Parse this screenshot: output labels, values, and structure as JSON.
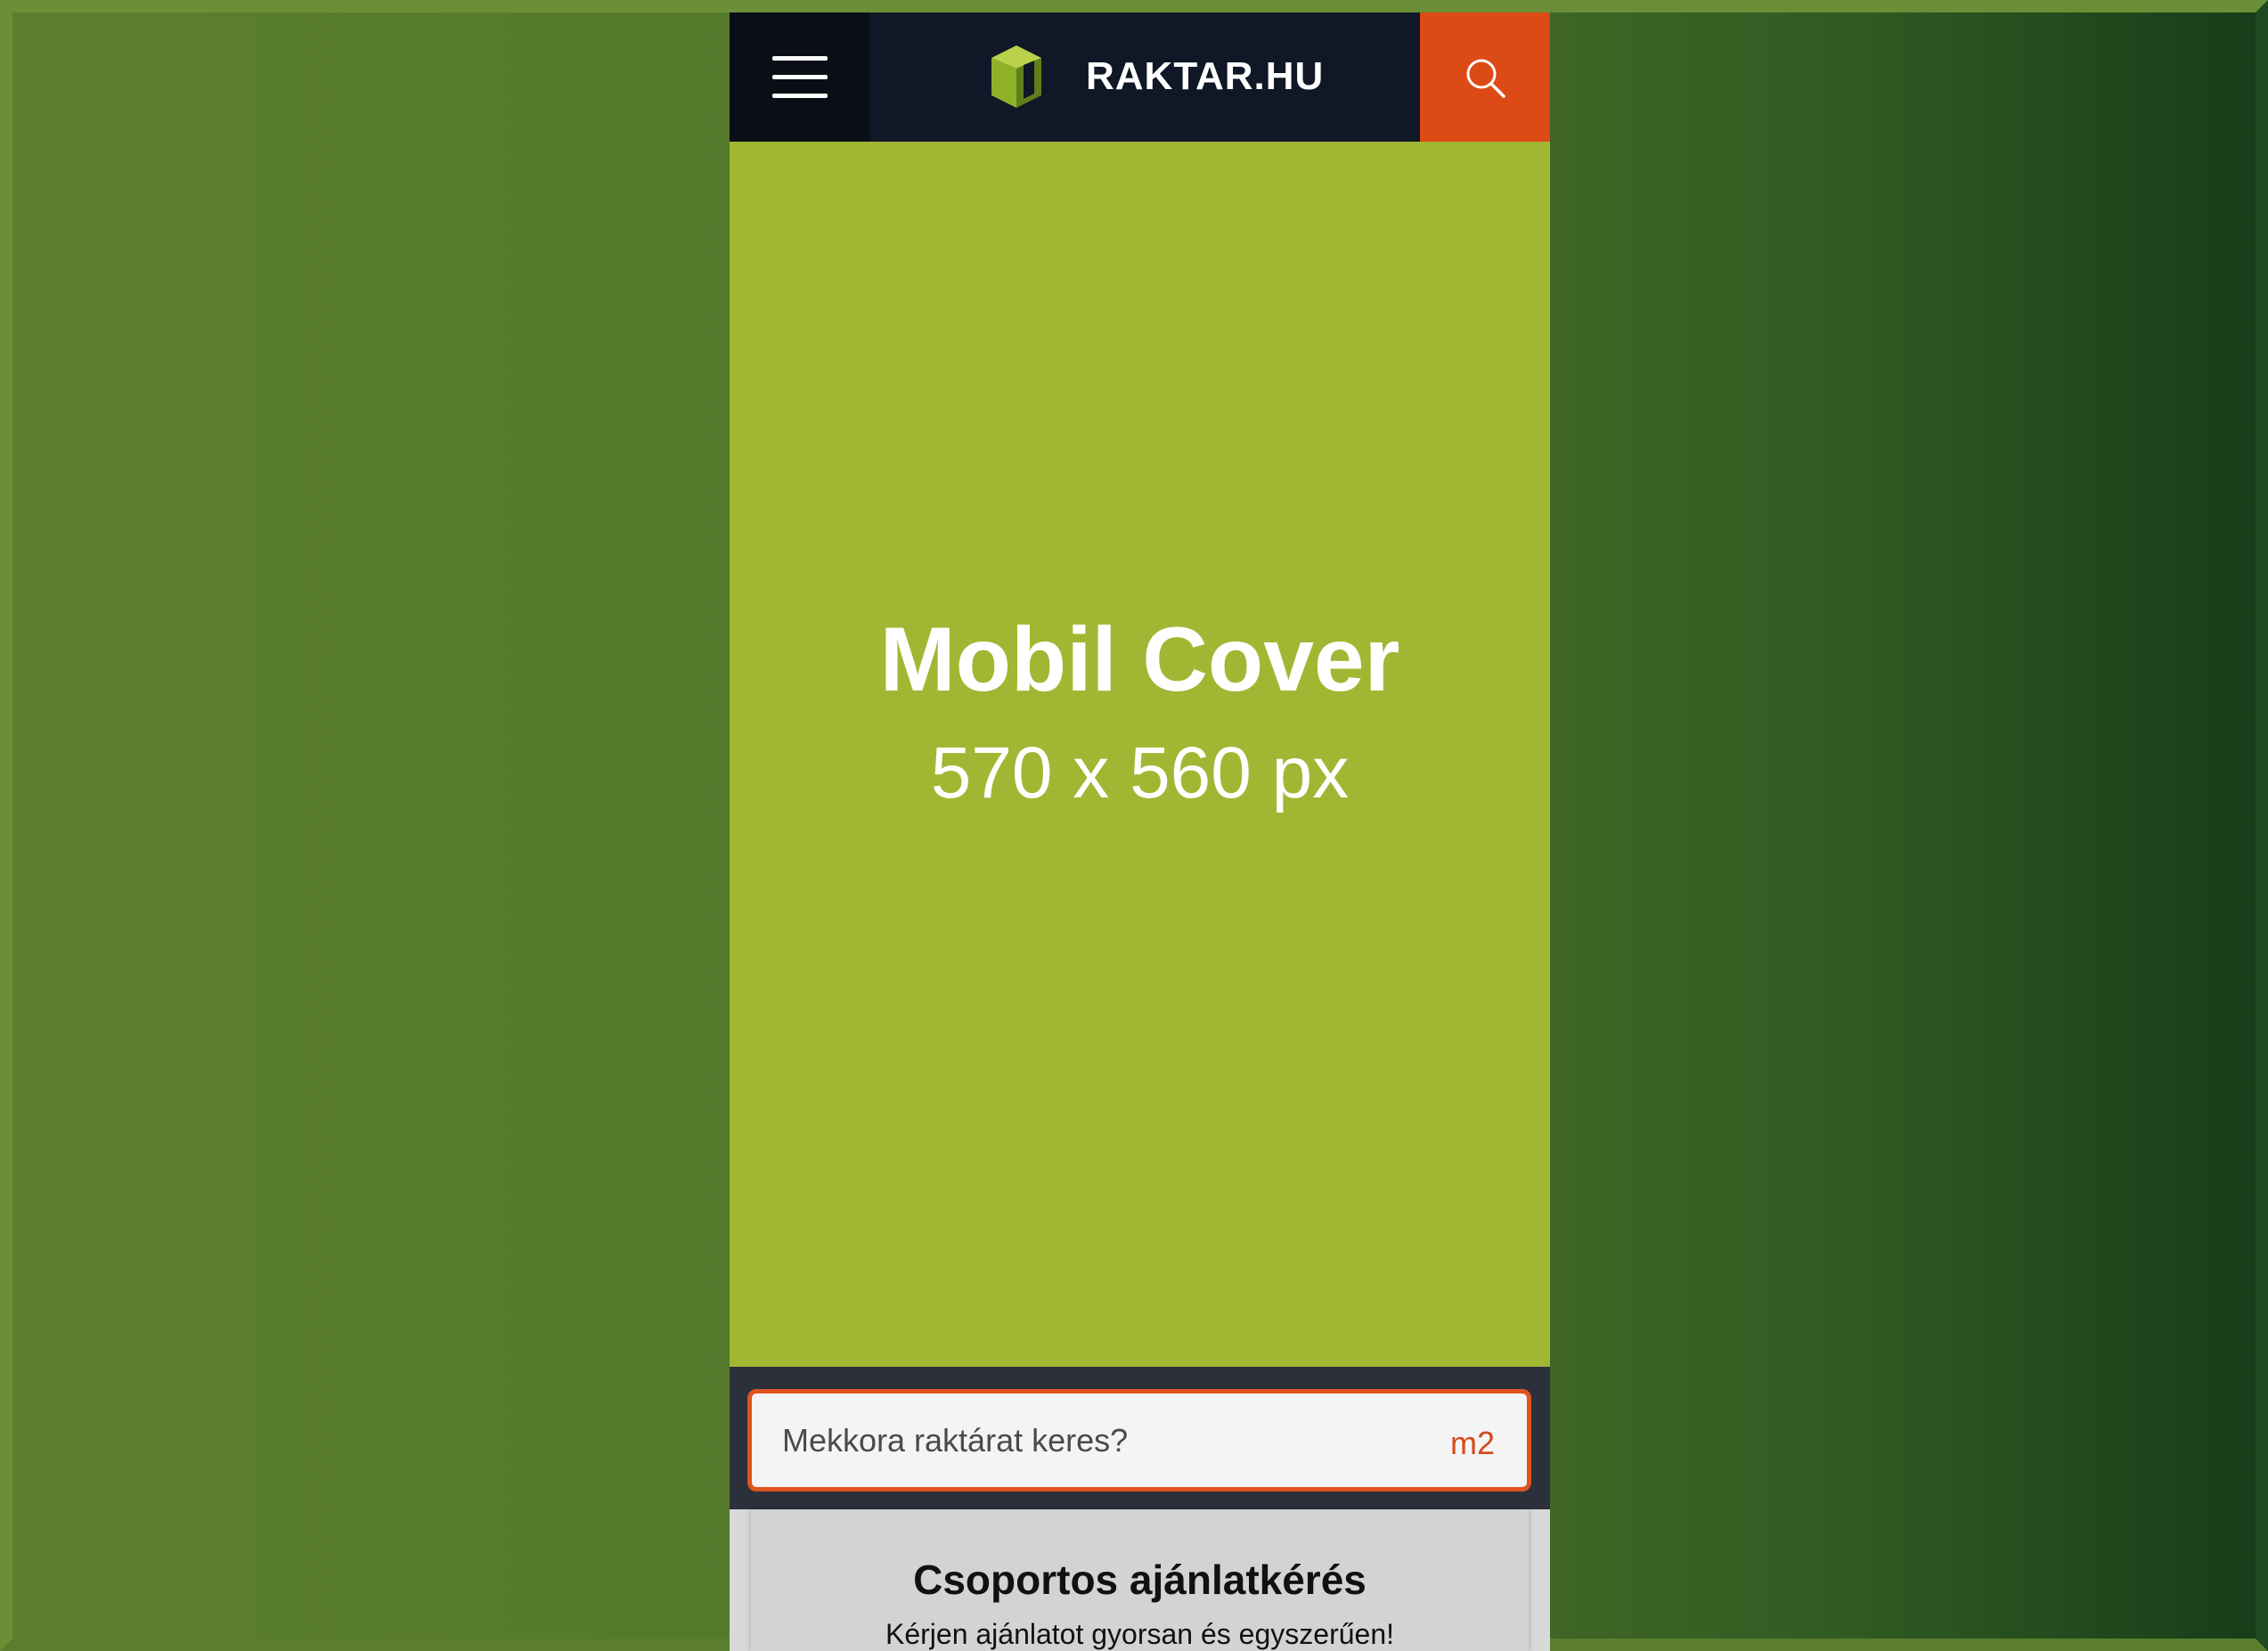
{
  "header": {
    "brand": "RAKTAR.HU",
    "menu_icon": "hamburger-menu-icon",
    "logo_icon": "cube-logo-icon",
    "search_icon": "search-icon"
  },
  "cover": {
    "title": "Mobil Cover",
    "size": "570 x 560 px"
  },
  "search": {
    "placeholder": "Mekkora raktárat keres?",
    "value": "",
    "unit": "m2"
  },
  "offer_card": {
    "title": "Csoportos ajánlatkérés",
    "subtitle": "Kérjen ajánlatot gyorsan és egyszerűen!"
  },
  "colors": {
    "header_bg": "#101827",
    "search_button_bg": "#dc4a15",
    "cover_bg": "#a1b733",
    "accent": "#e0531e",
    "logo_green": "#8fb12a"
  }
}
